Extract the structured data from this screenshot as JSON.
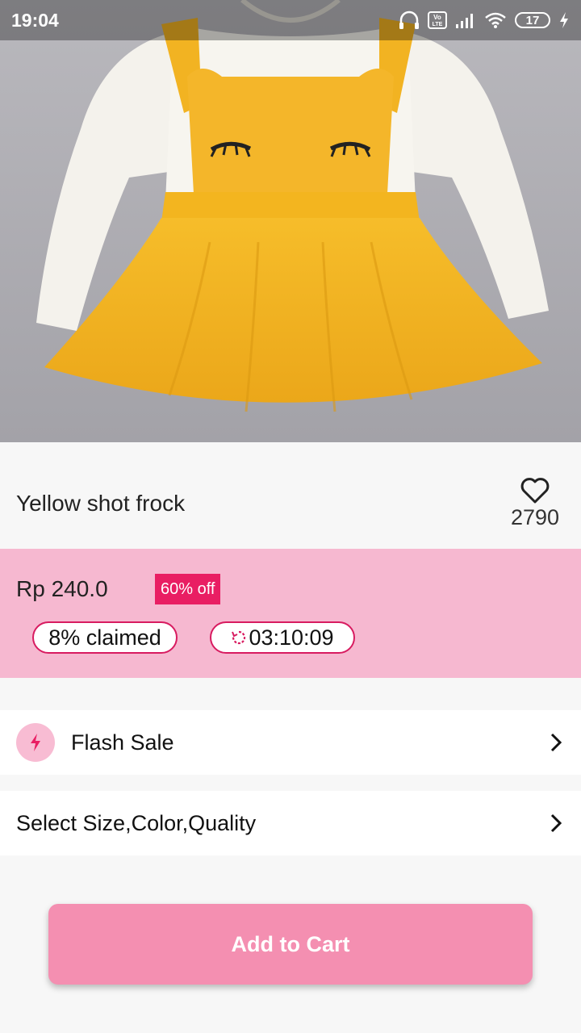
{
  "status_bar": {
    "time": "19:04",
    "network": "Vo LTE",
    "battery": "17"
  },
  "product": {
    "image_icon": "product-photo-yellow-frock",
    "title": "Yellow shot frock",
    "likes": "2790"
  },
  "pricing": {
    "price": "Rp 240.0",
    "discount": "60% off",
    "claimed": "8% claimed",
    "countdown": "03:10:09"
  },
  "options": {
    "flash_sale_label": "Flash Sale",
    "select_label": "Select Size,Color,Quality"
  },
  "actions": {
    "add_to_cart": "Add to Cart"
  },
  "colors": {
    "accent": "#e91e63",
    "price_band": "#f6b8d0",
    "button": "#f48fb1",
    "flash_circle": "#f8bcd3",
    "dress_yellow": "#f3b51f"
  }
}
